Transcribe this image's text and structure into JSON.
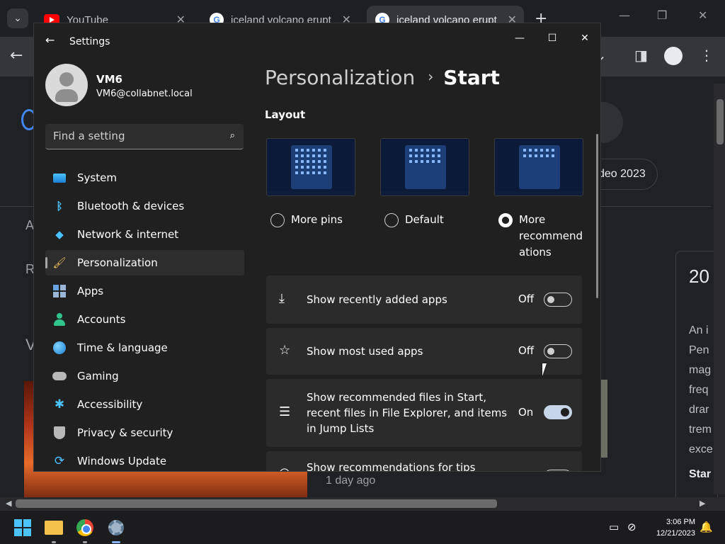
{
  "browser": {
    "tabs": [
      {
        "title": "YouTube",
        "favicon": "youtube-icon",
        "active": false
      },
      {
        "title": "iceland volcano erupt",
        "favicon": "google-icon",
        "active": false
      },
      {
        "title": "iceland volcano erupt",
        "favicon": "google-icon",
        "active": true
      }
    ],
    "page": {
      "chip_label": "deo 2023",
      "left_letters": [
        "A",
        "R",
        "V"
      ],
      "card_year": "20",
      "card_text": "An i\nPen\nmag\nfreq\ndrar\ntrem\nexce",
      "card_bold": "Star",
      "timestamp": "1 day ago"
    }
  },
  "settings": {
    "window_title": "Settings",
    "user": {
      "name": "VM6",
      "email": "VM6@collabnet.local"
    },
    "search_placeholder": "Find a setting",
    "nav": [
      {
        "label": "System",
        "icon": "monitor-icon"
      },
      {
        "label": "Bluetooth & devices",
        "icon": "bluetooth-icon"
      },
      {
        "label": "Network & internet",
        "icon": "wifi-icon"
      },
      {
        "label": "Personalization",
        "icon": "paintbrush-icon",
        "selected": true
      },
      {
        "label": "Apps",
        "icon": "apps-icon"
      },
      {
        "label": "Accounts",
        "icon": "person-icon"
      },
      {
        "label": "Time & language",
        "icon": "globe-clock-icon"
      },
      {
        "label": "Gaming",
        "icon": "gamepad-icon"
      },
      {
        "label": "Accessibility",
        "icon": "accessibility-icon"
      },
      {
        "label": "Privacy & security",
        "icon": "shield-icon"
      },
      {
        "label": "Windows Update",
        "icon": "refresh-icon"
      }
    ],
    "breadcrumb": {
      "parent": "Personalization",
      "separator": "›",
      "current": "Start"
    },
    "layout": {
      "heading": "Layout",
      "options": [
        {
          "label": "More pins",
          "selected": false
        },
        {
          "label": "Default",
          "selected": false
        },
        {
          "label": "More\nrecommend\nations",
          "selected": true
        }
      ]
    },
    "toggles": [
      {
        "label": "Show recently added apps",
        "state": "Off",
        "icon": "download-icon"
      },
      {
        "label": "Show most used apps",
        "state": "Off",
        "icon": "star-icon"
      },
      {
        "label": "Show recommended files in Start, recent files in File Explorer, and items in Jump Lists",
        "state": "On",
        "icon": "list-icon"
      },
      {
        "label": "Show recommendations for tips",
        "state": "",
        "icon": "lightbulb-icon"
      }
    ]
  },
  "taskbar": {
    "time": "3:06 PM",
    "date": "12/21/2023"
  },
  "colors": {
    "accent": "#4cc2ff",
    "window_bg": "#202020",
    "card_bg": "#2b2b2b",
    "toggle_on": "#c6d5e8"
  }
}
